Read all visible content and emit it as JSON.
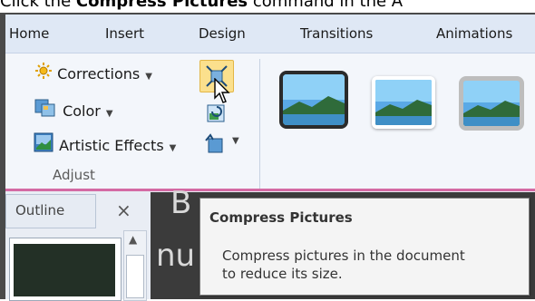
{
  "caption": {
    "prefix": "Click the ",
    "bold": "Compress Pictures",
    "suffix": " command in the A"
  },
  "ribbon_tabs": [
    "Home",
    "Insert",
    "Design",
    "Transitions",
    "Animations"
  ],
  "adjust_group": {
    "corrections": "Corrections",
    "color": "Color",
    "artistic_effects": "Artistic Effects",
    "label": "Adjust"
  },
  "pane": {
    "outline_tab": "Outline",
    "close_glyph": "×"
  },
  "slide_text": {
    "top": "B",
    "bottom": "nu"
  },
  "tooltip": {
    "title": "Compress Pictures",
    "line1": "Compress pictures in the document",
    "line2": "to reduce its size."
  },
  "icons": [
    "corrections-icon",
    "color-icon",
    "artistic-effects-icon",
    "compress-pictures-icon",
    "change-picture-icon",
    "reset-picture-icon",
    "cursor-icon",
    "close-icon",
    "scroll-up-icon"
  ],
  "colors": {
    "ribbon_tab_bar": "#dfe8f5",
    "ribbon_body": "#f3f6fb",
    "context_accent": "#d46aa4",
    "compress_button_highlight": "#fbe08d"
  }
}
